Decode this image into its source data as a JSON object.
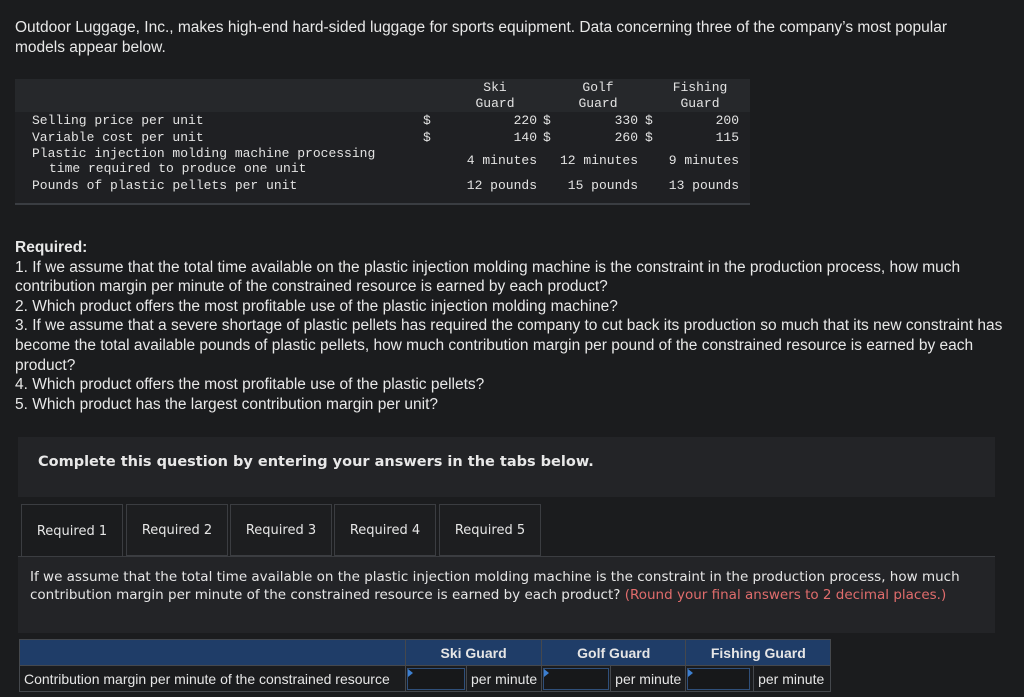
{
  "intro": {
    "text": "Outdoor Luggage, Inc., makes high-end hard-sided luggage for sports equipment. Data concerning three of the company’s most popular models appear below."
  },
  "data_table": {
    "columns": [
      {
        "line1": "Ski",
        "line2": "Guard"
      },
      {
        "line1": "Golf",
        "line2": "Guard"
      },
      {
        "line1": "Fishing",
        "line2": "Guard"
      }
    ],
    "rows": [
      {
        "label": "Selling price per unit",
        "currency": "$",
        "values": [
          "220",
          "330",
          "200"
        ]
      },
      {
        "label": "Variable cost per unit",
        "currency": "$",
        "values": [
          "140",
          "260",
          "115"
        ]
      },
      {
        "label_line1": "Plastic injection molding machine processing",
        "label_line2": "time required to produce one unit",
        "values": [
          "4 minutes",
          "12 minutes",
          "9 minutes"
        ]
      },
      {
        "label": "Pounds of plastic pellets per unit",
        "values": [
          "12 pounds",
          "15 pounds",
          "13 pounds"
        ]
      }
    ]
  },
  "required": {
    "heading": "Required:",
    "items": [
      "1. If we assume that the total time available on the plastic injection molding machine is the constraint in the production process, how much contribution margin per minute of the constrained resource is earned by each product?",
      "2. Which product offers the most profitable use of the plastic injection molding machine?",
      "3. If we assume that a severe shortage of plastic pellets has required the company to cut back its production so much that its new constraint has become the total available pounds of plastic pellets, how much contribution margin per pound of the constrained resource is earned by each product?",
      "4. Which product offers the most profitable use of the plastic pellets?",
      "5. Which product has the largest contribution margin per unit?"
    ]
  },
  "instructions": "Complete this question by entering your answers in the tabs below.",
  "tabs": [
    {
      "label": "Required 1",
      "active": true
    },
    {
      "label": "Required 2",
      "active": false
    },
    {
      "label": "Required 3",
      "active": false
    },
    {
      "label": "Required 4",
      "active": false
    },
    {
      "label": "Required 5",
      "active": false
    }
  ],
  "panel": {
    "question": "If we assume that the total time available on the plastic injection molding machine is the constraint in the production process, how much contribution margin per minute of the constrained resource is earned by each product?",
    "note": "(Round your final answers to 2 decimal places.)"
  },
  "answer_table": {
    "headers": [
      "Ski Guard",
      "Golf Guard",
      "Fishing Guard"
    ],
    "row_label": "Contribution margin per minute of the constrained resource",
    "unit": "per minute",
    "values": [
      "",
      "",
      ""
    ]
  },
  "colors": {
    "header_blue": "#1f3d68",
    "note_red": "#e06c6c",
    "input_marker": "#3c7fd0"
  }
}
